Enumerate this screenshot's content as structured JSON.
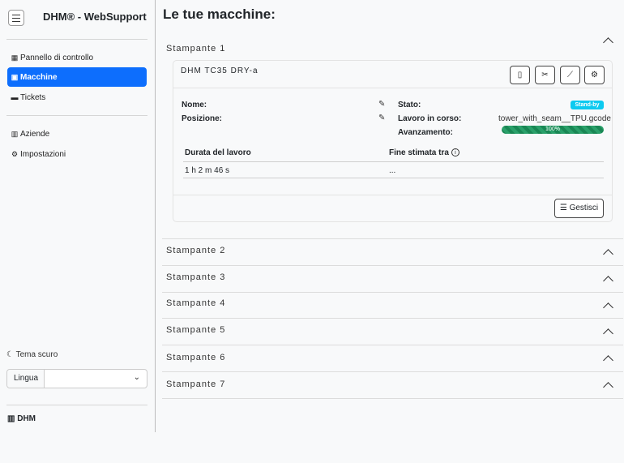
{
  "sidebar": {
    "brand": "DHM® - WebSupport",
    "nav": [
      {
        "icon": "dashboard-icon",
        "glyph": "▦",
        "label": "Pannello di controllo"
      },
      {
        "icon": "printer-icon",
        "glyph": "▣",
        "label": "Macchine"
      },
      {
        "icon": "ticket-icon",
        "glyph": "▬",
        "label": "Tickets"
      },
      {
        "icon": "building-icon",
        "glyph": "▥",
        "label": "Aziende"
      },
      {
        "icon": "gear-icon",
        "glyph": "⚙",
        "label": "Impostazioni"
      }
    ],
    "theme_label": "Tema scuro",
    "language_label": "Lingua",
    "language_value": "",
    "footer_brand": "DHM"
  },
  "main": {
    "title": "Le tue macchine:",
    "printers": [
      "Stampante 1",
      "Stampante 2",
      "Stampante 3",
      "Stampante 4",
      "Stampante 5",
      "Stampante 6",
      "Stampante 7"
    ],
    "card": {
      "machine_name": "DHM TC35 DRY-a",
      "name_label": "Nome:",
      "position_label": "Posizione:",
      "status_label": "Stato:",
      "status_value": "Stand-by",
      "job_label": "Lavoro in corso:",
      "job_value": "tower_with_seam__TPU.gcode",
      "progress_label": "Avanzamento:",
      "progress_text": "100%",
      "progress_percent": 100,
      "duration_header": "Durata del lavoro",
      "eta_header": "Fine stimata tra",
      "duration_value": "1 h 2 m 46 s",
      "eta_value": "...",
      "manage_label": "Gestisci"
    }
  },
  "colors": {
    "accent": "#0d6efd",
    "status_badge": "#0dcaf0",
    "progress": "#198754"
  }
}
